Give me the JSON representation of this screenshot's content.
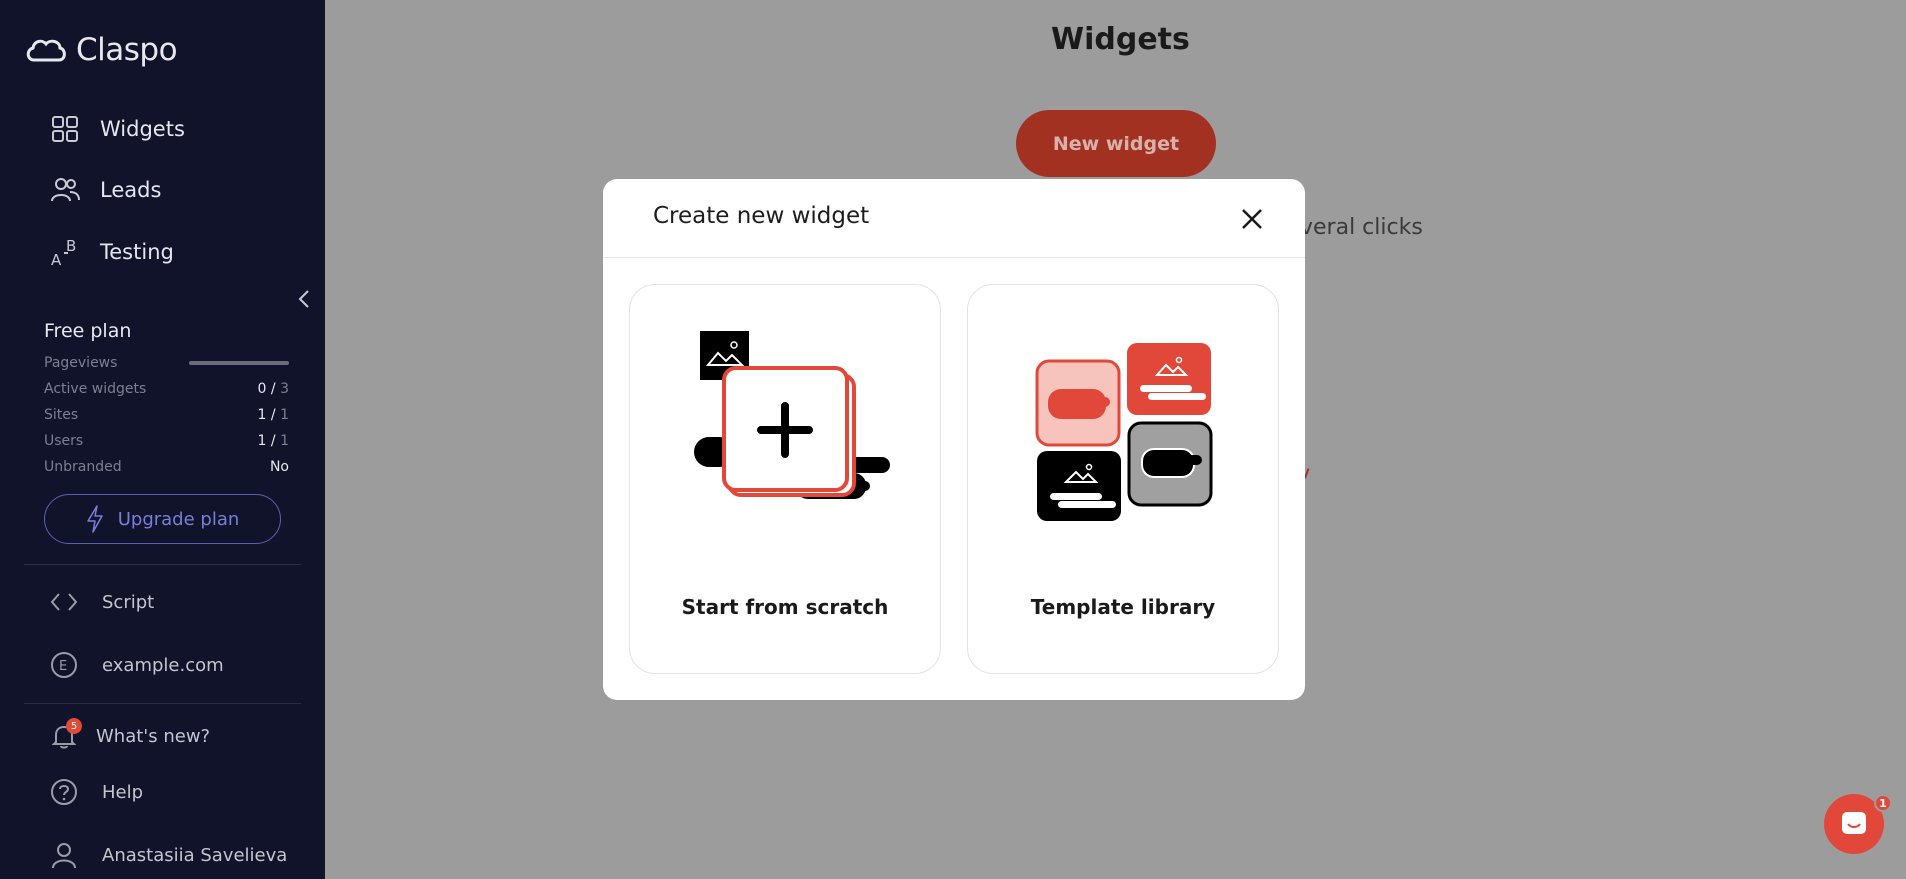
{
  "app": {
    "logo_text": "Claspo"
  },
  "sidebar": {
    "nav": [
      {
        "label": "Widgets",
        "icon": "grid-icon"
      },
      {
        "label": "Leads",
        "icon": "users-icon"
      },
      {
        "label": "Testing",
        "icon": "ab-test-icon"
      }
    ],
    "plan": {
      "title": "Free plan",
      "pageviews_label": "Pageviews",
      "pageviews_used_fraction": 0.0,
      "rows": [
        {
          "label": "Active widgets",
          "value": "0",
          "limit": "3"
        },
        {
          "label": "Sites",
          "value": "1",
          "limit": "1"
        },
        {
          "label": "Users",
          "value": "1",
          "limit": "1"
        }
      ],
      "unbranded_label": "Unbranded",
      "unbranded_value": "No"
    },
    "upgrade_label": "Upgrade plan",
    "links": [
      {
        "label": "Script",
        "icon": "code-icon"
      },
      {
        "label": "example.com",
        "icon": "site-e-icon"
      }
    ],
    "whats_new_label": "What's new?",
    "whats_new_count": "5",
    "help_label": "Help",
    "user_name": "Anastasiia Savelieva"
  },
  "main": {
    "title": "Widgets",
    "new_widget_label": "New widget",
    "bg_text": "veral clicks"
  },
  "modal": {
    "title": "Create new widget",
    "options": [
      {
        "label": "Start from scratch"
      },
      {
        "label": "Template library"
      }
    ]
  },
  "chat": {
    "badge_count": "1"
  },
  "colors": {
    "sidebar_bg": "#11132a",
    "accent": "#e2483a",
    "overlay_bg": "#9c9c9c"
  }
}
